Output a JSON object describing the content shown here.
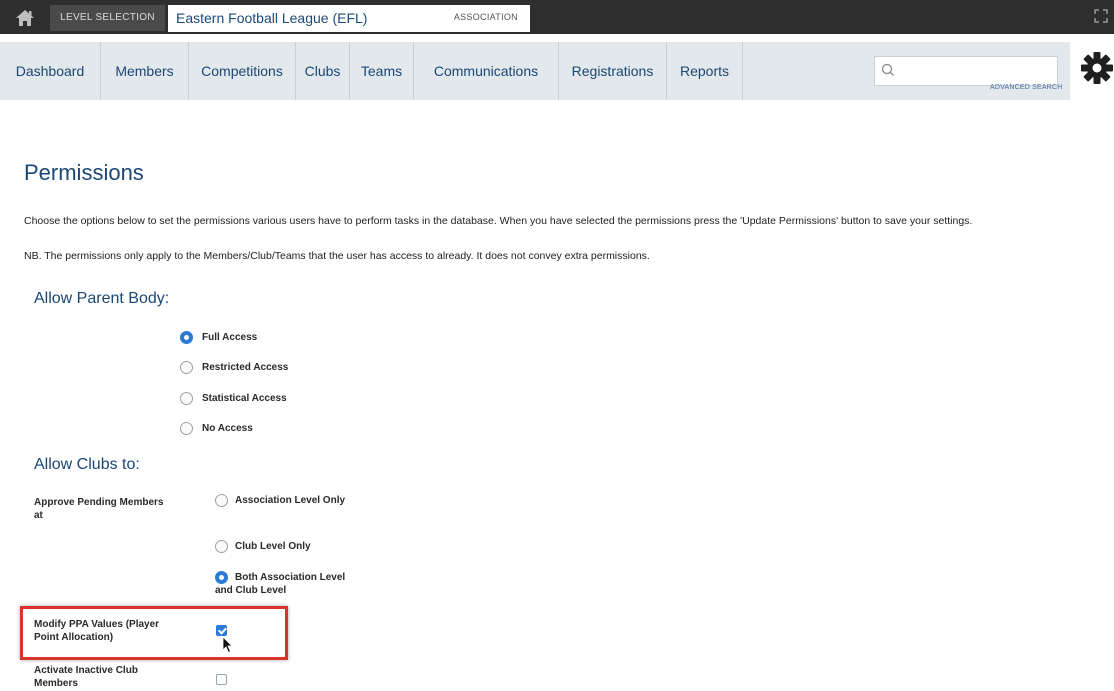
{
  "topbar": {
    "level_selection_label": "LEVEL SELECTION",
    "org_name": "Eastern Football League (EFL)",
    "org_type": "ASSOCIATION"
  },
  "nav": {
    "items": [
      {
        "label": "Dashboard"
      },
      {
        "label": "Members"
      },
      {
        "label": "Competitions"
      },
      {
        "label": "Clubs"
      },
      {
        "label": "Teams"
      },
      {
        "label": "Communications"
      },
      {
        "label": "Registrations"
      },
      {
        "label": "Reports"
      }
    ],
    "search": {
      "value": ""
    },
    "advanced_search_label": "ADVANCED SEARCH"
  },
  "page": {
    "title": "Permissions",
    "intro": "Choose the options below to set the permissions various users have to perform tasks in the database. When you have selected the permissions press the 'Update Permissions' button to save your settings.",
    "note": "NB. The permissions only apply to the Members/Club/Teams that the user has access to already. It does not convey extra permissions."
  },
  "parent_body": {
    "heading": "Allow Parent Body:",
    "options": [
      {
        "label": "Full Access",
        "selected": true
      },
      {
        "label": "Restricted Access",
        "selected": false
      },
      {
        "label": "Statistical Access",
        "selected": false
      },
      {
        "label": "No Access",
        "selected": false
      }
    ]
  },
  "clubs": {
    "heading": "Allow Clubs to:",
    "approve_label": "Approve Pending Members at",
    "approve_options": [
      {
        "label": "Association Level Only",
        "selected": false
      },
      {
        "label": "Club Level Only",
        "selected": false
      },
      {
        "label": "Both Association Level and Club Level",
        "selected": true
      }
    ],
    "modify_ppa_label": "Modify PPA Values (Player Point Allocation)",
    "modify_ppa_checked": true,
    "activate_label": "Activate Inactive Club Members",
    "activate_checked": false
  },
  "colors": {
    "brand_blue": "#1b4775",
    "selected_blue": "#2a7ad6",
    "highlight_red": "#d9342b",
    "topbar_dark": "#2e2e2e",
    "nav_bg": "#e3e8ec"
  }
}
